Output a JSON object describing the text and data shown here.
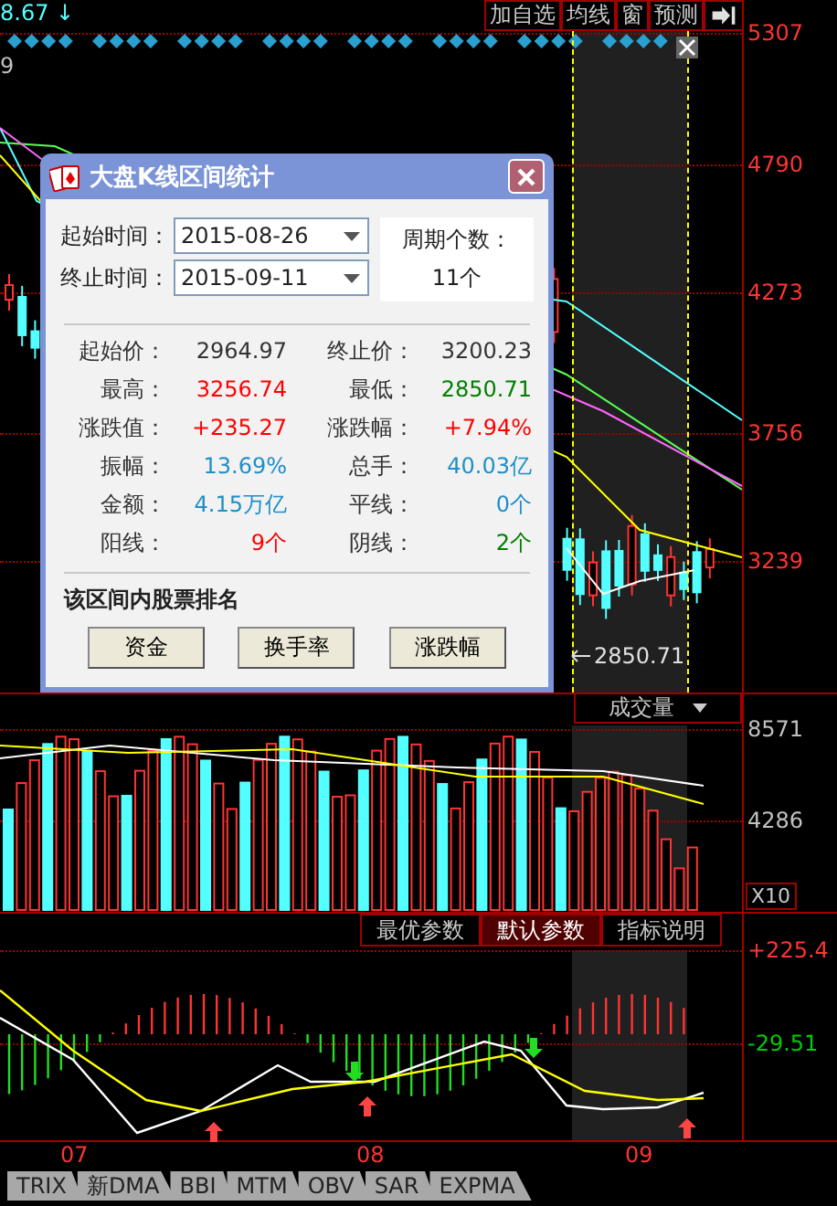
{
  "quote": {
    "price": "8.67",
    "arrow": "↓",
    "line2": "9"
  },
  "toolbar": [
    "加自选",
    "均线",
    "窗",
    "预测"
  ],
  "price_axis": [
    "5307",
    "4790",
    "4273",
    "3756",
    "3239"
  ],
  "low_marker": "2850.71",
  "dialog": {
    "title": "大盘K线区间统计",
    "start": {
      "label": "起始时间：",
      "value": "2015-08-26"
    },
    "end": {
      "label": "终止时间：",
      "value": "2015-09-11"
    },
    "period": {
      "label": "周期个数：",
      "value": "11个"
    },
    "stats": [
      {
        "label": "起始价：",
        "value": "2964.97",
        "color": "#333333"
      },
      {
        "label": "终止价：",
        "value": "3200.23",
        "color": "#333333"
      },
      {
        "label": "最高：",
        "value": "3256.74",
        "color": "#ff0000"
      },
      {
        "label": "最低：",
        "value": "2850.71",
        "color": "#008000"
      },
      {
        "label": "涨跌值：",
        "value": "+235.27",
        "color": "#ff0000"
      },
      {
        "label": "涨跌幅：",
        "value": "+7.94%",
        "color": "#ff0000"
      },
      {
        "label": "振幅：",
        "value": "13.69%",
        "color": "#1e8fc8"
      },
      {
        "label": "总手：",
        "value": "40.03亿",
        "color": "#1e8fc8"
      },
      {
        "label": "金额：",
        "value": "4.15万亿",
        "color": "#1e8fc8"
      },
      {
        "label": "平线：",
        "value": "0个",
        "color": "#1e8fc8"
      },
      {
        "label": "阳线：",
        "value": "9个",
        "color": "#ff0000"
      },
      {
        "label": "阴线：",
        "value": "2个",
        "color": "#008000"
      }
    ],
    "ranking": {
      "title": "该区间内股票排名",
      "buttons": [
        "资金",
        "换手率",
        "涨跌幅"
      ]
    }
  },
  "volume": {
    "indicator": "成交量",
    "axis": [
      "8571",
      "4286"
    ],
    "scale": "X10"
  },
  "macd": {
    "buttons": [
      {
        "label": "最优参数",
        "selected": false
      },
      {
        "label": "默认参数",
        "selected": true
      },
      {
        "label": "指标说明",
        "selected": false
      }
    ],
    "axis": [
      {
        "label": "+225.4",
        "color": "#ff3333"
      },
      {
        "label": "-29.51",
        "color": "#00cc00"
      }
    ]
  },
  "dates": [
    "07",
    "08",
    "09"
  ],
  "tabs": [
    "TRIX",
    "新DMA",
    "BBI",
    "MTM",
    "OBV",
    "SAR",
    "EXPMA"
  ]
}
